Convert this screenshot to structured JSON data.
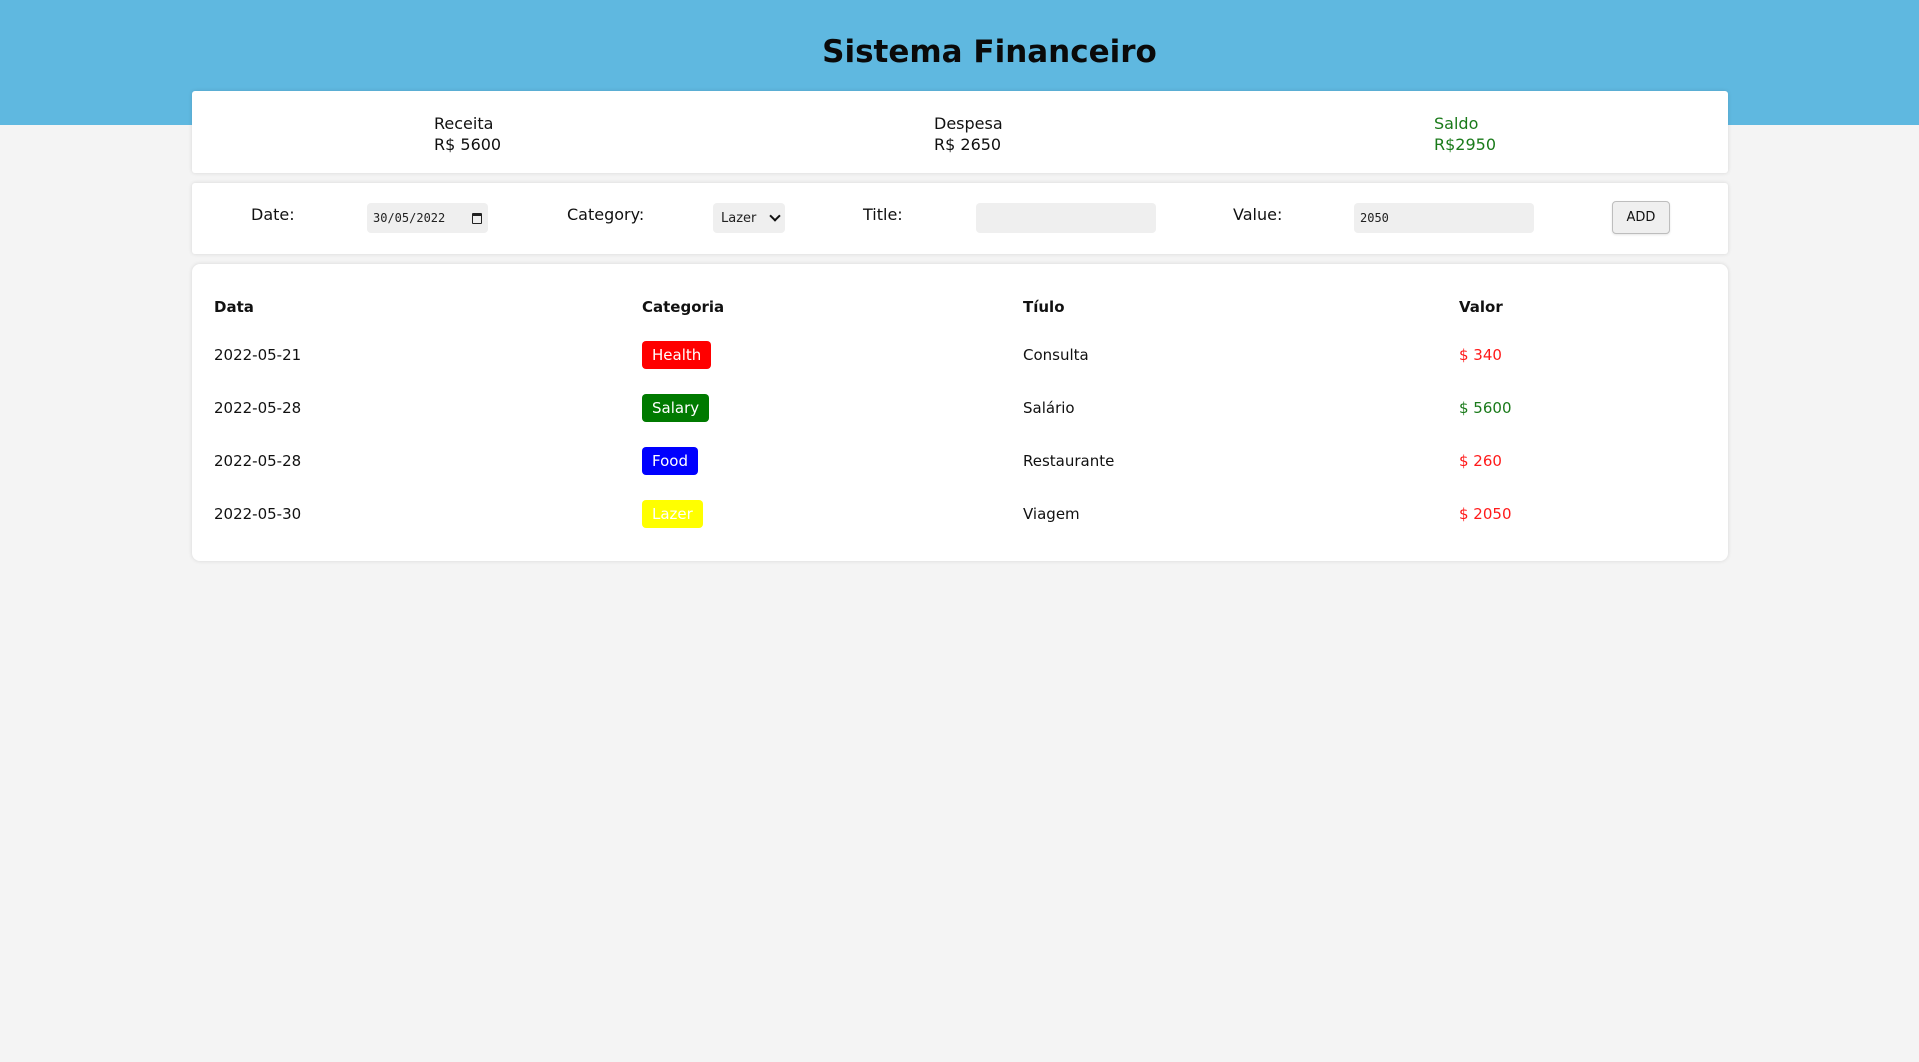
{
  "header": {
    "title": "Sistema Financeiro",
    "band_color": "#5fb8e0"
  },
  "summary": {
    "receita_label": "Receita",
    "receita_value": "R$ 5600",
    "despesa_label": "Despesa",
    "despesa_value": "R$ 2650",
    "saldo_label": "Saldo",
    "saldo_value": "R$2950",
    "saldo_color": "#1a7a1a"
  },
  "form": {
    "date_label": "Date:",
    "date_value": "30/05/2022",
    "category_label": "Category:",
    "category_value": "Lazer",
    "title_label": "Title:",
    "title_value": "",
    "value_label": "Value:",
    "value_value": "2050",
    "add_label": "ADD"
  },
  "table": {
    "headers": [
      "Data",
      "Categoria",
      "Tíulo",
      "Valor"
    ],
    "rows": [
      {
        "date": "2022-05-21",
        "category": "Health",
        "category_color": "#ff0000",
        "title": "Consulta",
        "value": "$ 340",
        "type": "expense"
      },
      {
        "date": "2022-05-28",
        "category": "Salary",
        "category_color": "#007a00",
        "title": "Salário",
        "value": "$ 5600",
        "type": "income"
      },
      {
        "date": "2022-05-28",
        "category": "Food",
        "category_color": "#0000ff",
        "title": "Restaurante",
        "value": "$ 260",
        "type": "expense"
      },
      {
        "date": "2022-05-30",
        "category": "Lazer",
        "category_color": "#ffff00",
        "title": "Viagem",
        "value": "$ 2050",
        "type": "expense"
      }
    ]
  }
}
